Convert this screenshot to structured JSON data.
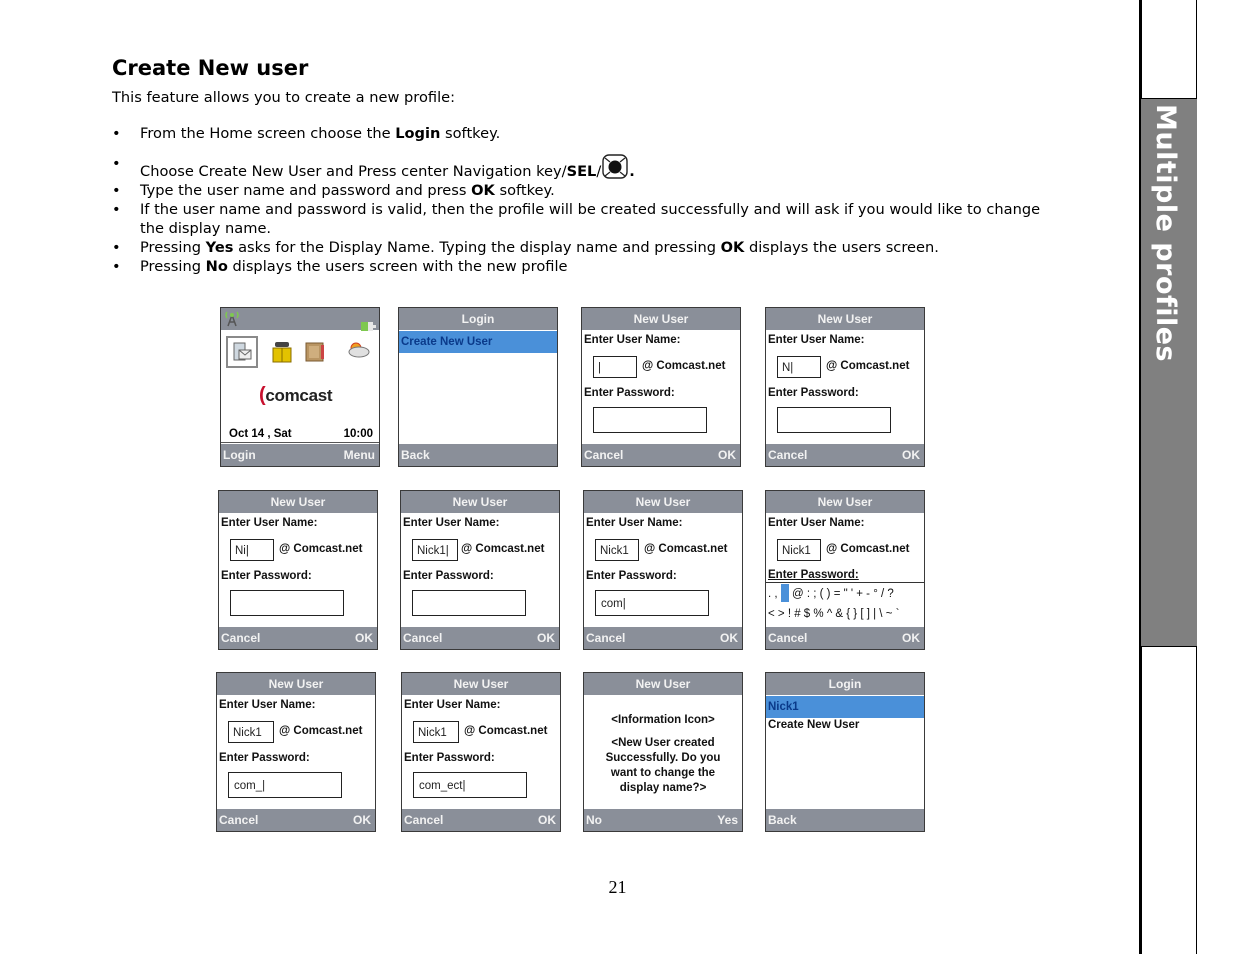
{
  "page": {
    "title": "Create New user",
    "intro": "This feature allows you to create a new profile:",
    "bullets": [
      {
        "pre": "From the Home screen choose the ",
        "bold": "Login",
        "post": " softkey."
      },
      {
        "pre": "Choose Create New User and Press center Navigation key/",
        "bold": "SEL",
        "post": "/",
        "icon": "navigation-key-icon",
        "end": "."
      },
      {
        "pre": "Type the user name and password and press ",
        "bold": "OK",
        "post": " softkey."
      },
      {
        "text": "If the user name and password is valid, then the profile will be created successfully and will ask if you would like to change the display name."
      },
      {
        "pre": "Pressing ",
        "bold": "Yes",
        "mid": " asks for the Display Name. Typing the display name and pressing ",
        "bold2": "OK",
        "post": " displays the users screen."
      },
      {
        "pre": "Pressing ",
        "bold": "No",
        "post": " displays the users screen with the new profile"
      }
    ],
    "page_number": "21",
    "side_tab": "Multiple profiles"
  },
  "common": {
    "new_user": "New User",
    "login": "Login",
    "enter_user_name": "Enter User Name:",
    "enter_password": "Enter Password:",
    "domain": "@ Comcast.net",
    "cancel": "Cancel",
    "ok": "OK",
    "back": "Back",
    "create_new_user": "Create New User"
  },
  "screens": {
    "home": {
      "logo": "comcast",
      "date": "Oct 14 , Sat",
      "time": "10:00",
      "left_softkey": "Login",
      "right_softkey": "Menu",
      "icons": [
        "signal-antenna-icon",
        "battery-icon",
        "messages-icon",
        "phonebook-icon",
        "notebook-icon",
        "weather-icon"
      ]
    },
    "login_empty": {
      "title": "Login",
      "selected": "Create New User",
      "left_softkey": "Back"
    },
    "new_user_1": {
      "username": "|",
      "password": ""
    },
    "new_user_2": {
      "username": "N|",
      "password": ""
    },
    "new_user_3": {
      "username": "Ni|",
      "password": ""
    },
    "new_user_4": {
      "username": "Nick1|",
      "password": ""
    },
    "new_user_5": {
      "username": "Nick1",
      "password": "com|"
    },
    "new_user_6": {
      "username": "Nick1",
      "symbols_row1_pre": ". ,",
      "symbols_row1_post": " @ : ; ( ) = \" ' + - ° / ?",
      "symbols_row2": "< > ! # $ % ^ & { } [ ] | \\ ~ `"
    },
    "new_user_7": {
      "username": "Nick1",
      "password": "com_|"
    },
    "new_user_8": {
      "username": "Nick1",
      "password": "com_ect|"
    },
    "confirm": {
      "title": "New User",
      "line1": "<Information Icon>",
      "line2": "<New User created",
      "line3": "Successfully. Do you",
      "line4": "want to change the",
      "line5": "display name?>",
      "left_softkey": "No",
      "right_softkey": "Yes"
    },
    "login_with_user": {
      "title": "Login",
      "selected": "Nick1",
      "item2": "Create New User",
      "left_softkey": "Back"
    }
  }
}
